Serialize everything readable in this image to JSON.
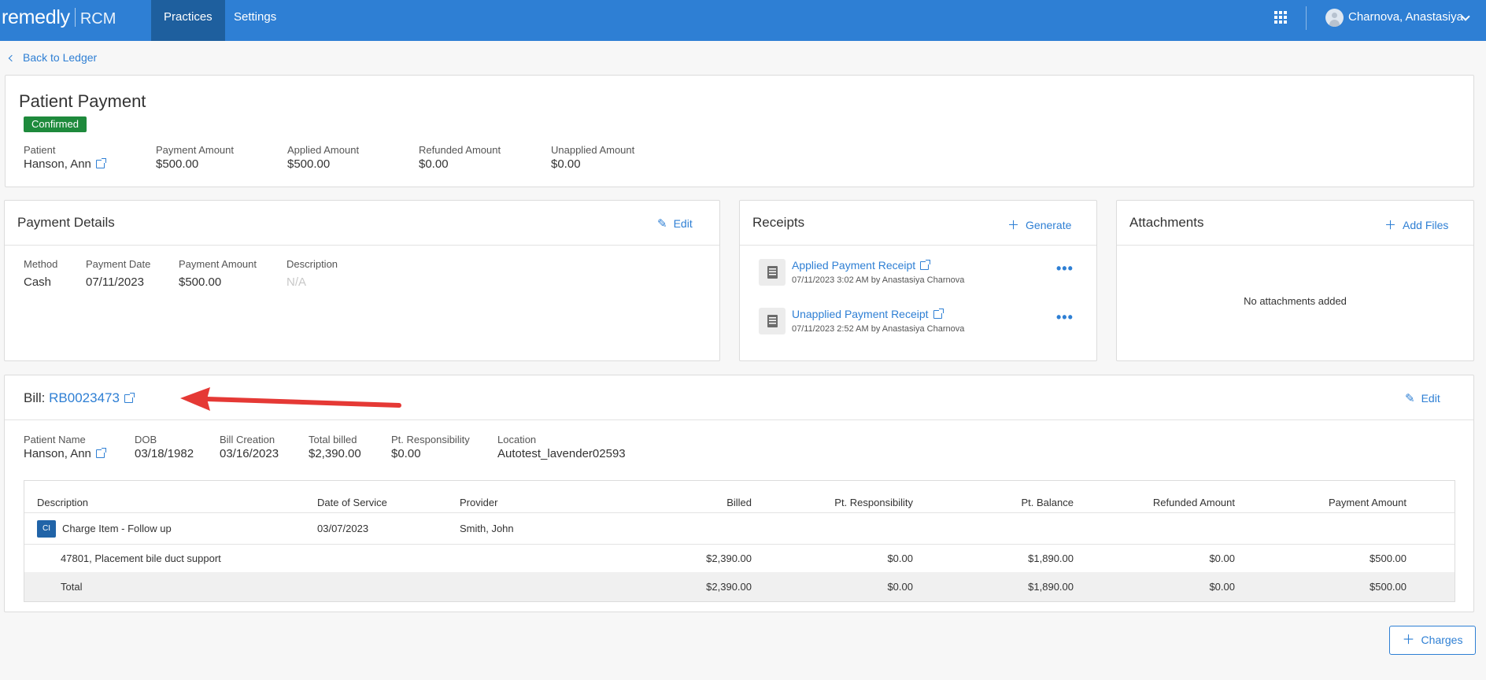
{
  "nav": {
    "brand": "remedly",
    "product": "RCM",
    "tabs": [
      {
        "label": "Practices"
      },
      {
        "label": "Settings"
      }
    ],
    "user_name": "Charnova, Anastasiya"
  },
  "back_label": "Back to Ledger",
  "summary": {
    "title": "Patient Payment",
    "status": "Confirmed",
    "fields": [
      {
        "label": "Patient",
        "value": "Hanson, Ann"
      },
      {
        "label": "Payment Amount",
        "value": "$500.00"
      },
      {
        "label": "Applied Amount",
        "value": "$500.00"
      },
      {
        "label": "Refunded Amount",
        "value": "$0.00"
      },
      {
        "label": "Unapplied Amount",
        "value": "$0.00"
      }
    ]
  },
  "payment_details": {
    "title": "Payment Details",
    "edit_label": "Edit",
    "fields": [
      {
        "label": "Method",
        "value": "Cash"
      },
      {
        "label": "Payment Date",
        "value": "07/11/2023"
      },
      {
        "label": "Payment Amount",
        "value": "$500.00"
      },
      {
        "label": "Description",
        "value": "N/A"
      }
    ]
  },
  "receipts": {
    "title": "Receipts",
    "generate_label": "Generate",
    "items": [
      {
        "name": "Applied Payment Receipt",
        "meta": "07/11/2023 3:02 AM by Anastasiya Charnova"
      },
      {
        "name": "Unapplied Payment Receipt",
        "meta": "07/11/2023 2:52 AM by Anastasiya Charnova"
      }
    ]
  },
  "attachments": {
    "title": "Attachments",
    "add_label": "Add Files",
    "empty_text": "No attachments added"
  },
  "bill": {
    "prefix": "Bill:",
    "number": "RB0023473",
    "edit_label": "Edit",
    "fields": [
      {
        "label": "Patient Name",
        "value": "Hanson, Ann"
      },
      {
        "label": "DOB",
        "value": "03/18/1982"
      },
      {
        "label": "Bill Creation",
        "value": "03/16/2023"
      },
      {
        "label": "Total billed",
        "value": "$2,390.00"
      },
      {
        "label": "Pt. Responsibility",
        "value": "$0.00"
      },
      {
        "label": "Location",
        "value": "Autotest_lavender02593"
      }
    ],
    "table": {
      "columns": [
        "Description",
        "Date of Service",
        "Provider",
        "Billed",
        "Pt. Responsibility",
        "Pt. Balance",
        "Refunded Amount",
        "Payment Amount"
      ],
      "charge_item": {
        "badge": "CI",
        "description": "Charge Item - Follow up",
        "date_of_service": "03/07/2023",
        "provider": "Smith, John"
      },
      "line": {
        "description": "47801, Placement bile duct support",
        "billed": "$2,390.00",
        "pt_responsibility": "$0.00",
        "pt_balance": "$1,890.00",
        "refunded": "$0.00",
        "payment": "$500.00"
      },
      "total": {
        "label": "Total",
        "billed": "$2,390.00",
        "pt_responsibility": "$0.00",
        "pt_balance": "$1,890.00",
        "refunded": "$0.00",
        "payment": "$500.00"
      }
    }
  },
  "charges_button_label": "Charges",
  "colors": {
    "primary": "#2e7fd4",
    "nav_active": "#1e5f9e",
    "confirmed": "#1e8a3c",
    "annotation_arrow": "#e53935"
  }
}
